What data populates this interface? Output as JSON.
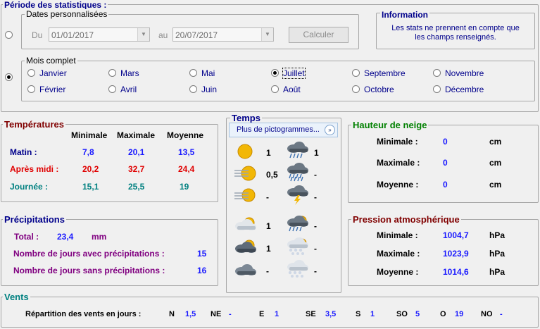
{
  "periode": {
    "title": "Période des statistiques :",
    "dates": {
      "legend": "Dates personnalisées",
      "du_label": "Du",
      "du_value": "01/01/2017",
      "au_label": "au",
      "au_value": "20/07/2017",
      "calc_button": "Calculer"
    },
    "info": {
      "title": "Information",
      "line1": "Les stats ne prennent en compte que",
      "line2": "les champs renseignés."
    },
    "mois": {
      "legend": "Mois complet",
      "selected": "Juillet",
      "months": [
        "Janvier",
        "Mars",
        "Mai",
        "Juillet",
        "Septembre",
        "Novembre",
        "Février",
        "Avril",
        "Juin",
        "Août",
        "Octobre",
        "Décembre"
      ]
    }
  },
  "temperatures": {
    "title": "Températures",
    "headers": [
      "Minimale",
      "Maximale",
      "Moyenne"
    ],
    "rows": [
      {
        "label": "Matin :",
        "min": "7,8",
        "max": "20,1",
        "moy": "13,5"
      },
      {
        "label": "Après midi :",
        "min": "20,2",
        "max": "32,7",
        "moy": "24,4"
      },
      {
        "label": "Journée :",
        "min": "15,1",
        "max": "25,5",
        "moy": "19"
      }
    ]
  },
  "temps": {
    "title": "Temps",
    "dropdown": "Plus de pictogrammes...",
    "left": [
      {
        "icon": "sun-icon",
        "value": "1"
      },
      {
        "icon": "sun-fog-icon",
        "value": "0,5"
      },
      {
        "icon": "fog-icon",
        "value": "-"
      },
      {
        "icon": "partly-cloudy-icon",
        "value": "1"
      },
      {
        "icon": "dark-partly-cloudy-icon",
        "value": "1"
      },
      {
        "icon": "overcast-icon",
        "value": "-"
      }
    ],
    "right": [
      {
        "icon": "rain-cloud-icon",
        "value": "1"
      },
      {
        "icon": "heavy-rain-icon",
        "value": "-"
      },
      {
        "icon": "thunderstorm-icon",
        "value": "-"
      },
      {
        "icon": "sun-rain-icon",
        "value": "-"
      },
      {
        "icon": "snow-rain-icon",
        "value": "-"
      },
      {
        "icon": "snow-icon",
        "value": "-"
      }
    ]
  },
  "neige": {
    "title": "Hauteur de neige",
    "rows": [
      {
        "label": "Minimale :",
        "value": "0",
        "unit": "cm"
      },
      {
        "label": "Maximale :",
        "value": "0",
        "unit": "cm"
      },
      {
        "label": "Moyenne :",
        "value": "0",
        "unit": "cm"
      }
    ]
  },
  "precipitations": {
    "title": "Précipitations",
    "total_label": "Total :",
    "total_value": "23,4",
    "total_unit": "mm",
    "avec_label": "Nombre de jours avec précipitations :",
    "avec_value": "15",
    "sans_label": "Nombre de jours sans précipitations :",
    "sans_value": "16"
  },
  "pression": {
    "title": "Pression atmosphérique",
    "rows": [
      {
        "label": "Minimale :",
        "value": "1004,7",
        "unit": "hPa"
      },
      {
        "label": "Maximale :",
        "value": "1023,9",
        "unit": "hPa"
      },
      {
        "label": "Moyenne :",
        "value": "1014,6",
        "unit": "hPa"
      }
    ]
  },
  "vents": {
    "title": "Vents",
    "label": "Répartition des vents en jours :",
    "dirs": [
      {
        "dir": "N",
        "value": "1,5"
      },
      {
        "dir": "NE",
        "value": "-"
      },
      {
        "dir": "E",
        "value": "1"
      },
      {
        "dir": "SE",
        "value": "3,5"
      },
      {
        "dir": "S",
        "value": "1"
      },
      {
        "dir": "SO",
        "value": "5"
      },
      {
        "dir": "O",
        "value": "19"
      },
      {
        "dir": "NO",
        "value": "-"
      }
    ]
  },
  "colors": {
    "navy": "#00008b",
    "blue": "#1a1aff",
    "red": "#e00000",
    "teal": "#008080",
    "purple": "#800080",
    "green": "#008000",
    "maroon": "#800000"
  }
}
